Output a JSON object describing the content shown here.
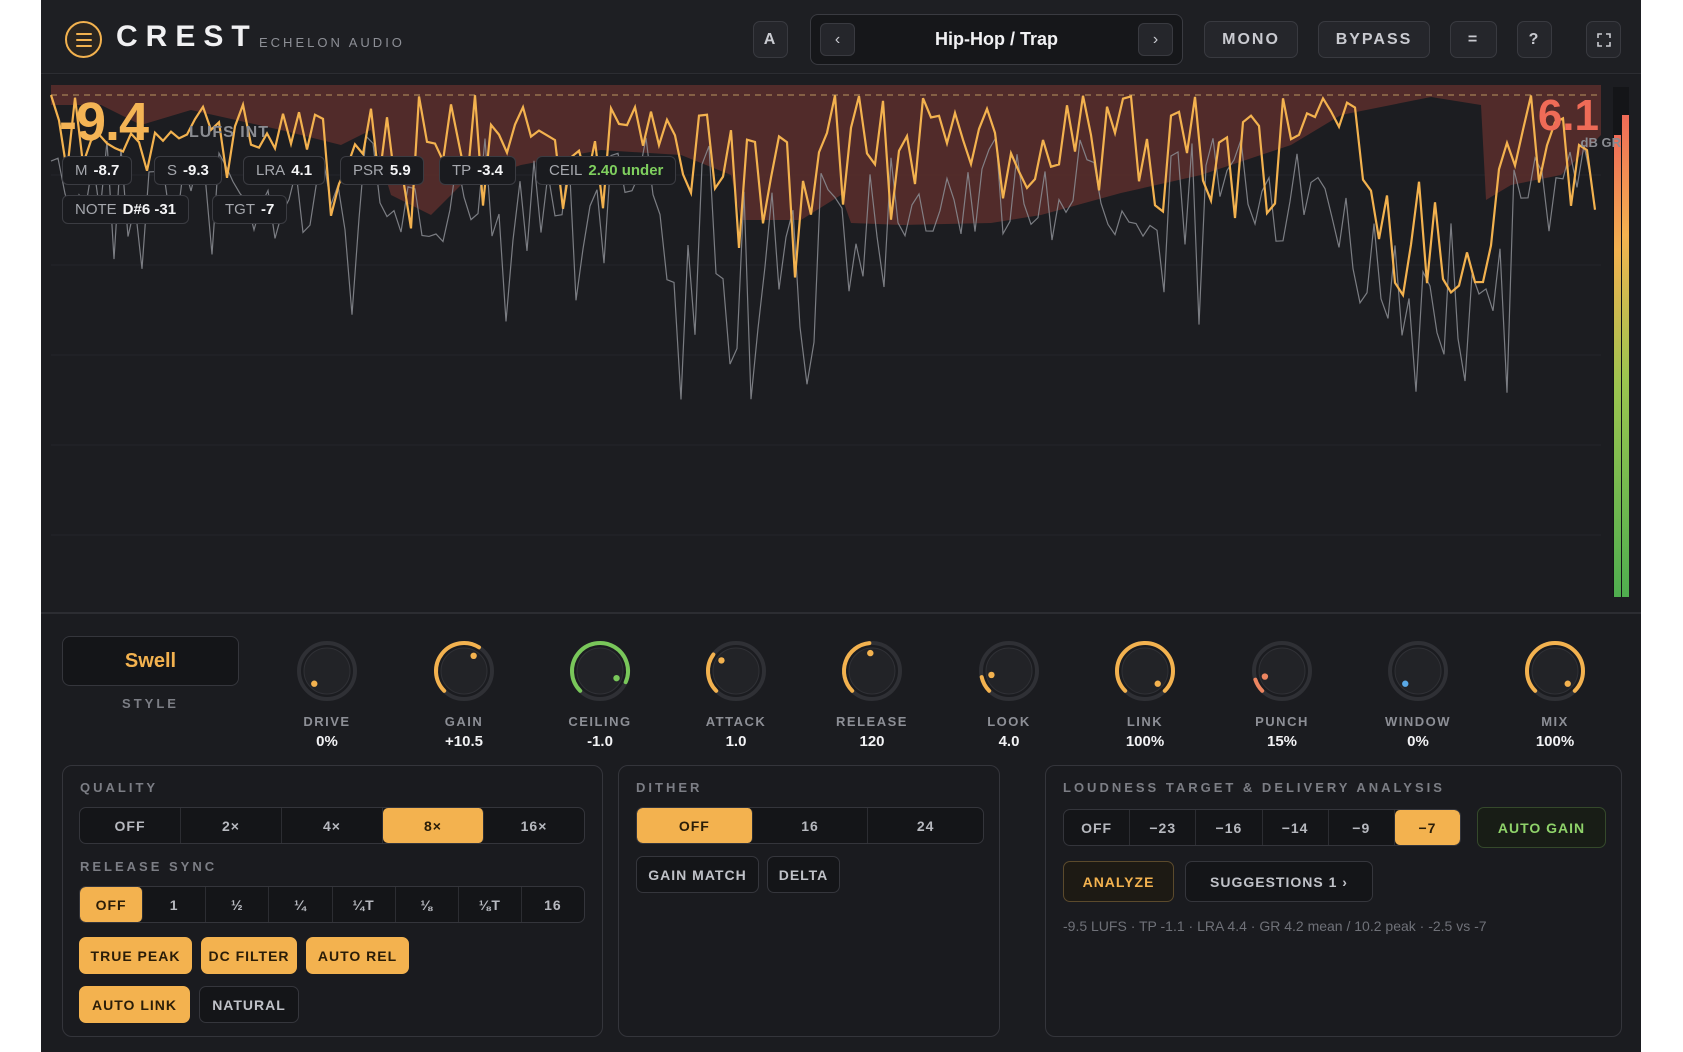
{
  "header": {
    "brand": "CREST",
    "maker": "ECHELON AUDIO",
    "ab_label": "A",
    "prev_label": "‹",
    "preset_name": "Hip-Hop / Trap",
    "next_label": "›",
    "mono_label": "MONO",
    "bypass_label": "BYPASS",
    "compare_label": "=",
    "help_label": "?"
  },
  "display": {
    "lufs_value": "-9.4",
    "lufs_unit": "LUFS INT",
    "gr_value": "6.1",
    "gr_unit": "dB GR",
    "chips": [
      {
        "label": "M",
        "value": "-8.7"
      },
      {
        "label": "S",
        "value": "-9.3"
      },
      {
        "label": "LRA",
        "value": "4.1"
      },
      {
        "label": "PSR",
        "value": "5.9"
      },
      {
        "label": "TP",
        "value": "-3.4"
      },
      {
        "label": "CEIL",
        "value": "2.40 under"
      },
      {
        "label": "NOTE",
        "value": "D#6 -31"
      },
      {
        "label": "TGT",
        "value": "-7"
      }
    ]
  },
  "style": {
    "value": "Swell",
    "label": "STYLE"
  },
  "knobs": [
    {
      "label": "DRIVE",
      "value": "0%",
      "level": 0.0,
      "color": "#f3b24f"
    },
    {
      "label": "GAIN",
      "value": "+10.5",
      "level": 0.62,
      "color": "#f3b24f"
    },
    {
      "label": "CEILING",
      "value": "-1.0",
      "level": 0.92,
      "color": "#79c75a"
    },
    {
      "label": "ATTACK",
      "value": "1.0",
      "level": 0.3,
      "color": "#f3b24f"
    },
    {
      "label": "RELEASE",
      "value": "120",
      "level": 0.48,
      "color": "#f3b24f"
    },
    {
      "label": "LOOK",
      "value": "4.0",
      "level": 0.12,
      "color": "#f3b24f"
    },
    {
      "label": "LINK",
      "value": "100%",
      "level": 1.0,
      "color": "#f3b24f"
    },
    {
      "label": "PUNCH",
      "value": "15%",
      "level": 0.1,
      "color": "#ec8560"
    },
    {
      "label": "WINDOW",
      "value": "0%",
      "level": 0.0,
      "color": "#5aa9e6"
    },
    {
      "label": "MIX",
      "value": "100%",
      "level": 1.0,
      "color": "#f3b24f"
    }
  ],
  "quality": {
    "title": "QUALITY",
    "options": [
      "OFF",
      "2×",
      "4×",
      "8×",
      "16×"
    ],
    "selected": "8×",
    "release_sync_title": "RELEASE SYNC",
    "release_sync_options": [
      "OFF",
      "1",
      "½",
      "¼",
      "¼T",
      "⅛",
      "⅛T",
      "16"
    ],
    "release_sync_selected": "OFF",
    "toggles_row1": [
      "TRUE PEAK",
      "DC FILTER",
      "AUTO REL"
    ],
    "toggles_row2_on": "AUTO LINK",
    "toggles_row2_off": "NATURAL"
  },
  "dither": {
    "title": "DITHER",
    "options": [
      "OFF",
      "16",
      "24"
    ],
    "selected": "OFF",
    "gain_match": "GAIN MATCH",
    "delta": "DELTA"
  },
  "loudness": {
    "title": "LOUDNESS TARGET & DELIVERY ANALYSIS",
    "options": [
      "OFF",
      "−23",
      "−16",
      "−14",
      "−9",
      "−7"
    ],
    "selected": "−7",
    "auto_gain": "AUTO GAIN",
    "analyze": "ANALYZE",
    "suggestions": "SUGGESTIONS  1 ›",
    "analysis_text": "-9.5 LUFS · TP -1.1 · LRA 4.4 · GR 4.2 mean / 10.2 peak · -2.5 vs -7"
  },
  "colors": {
    "accent": "#f3b24f",
    "gr_fill": "#5a2e2c",
    "gr_number": "#ef6b57",
    "good": "#7fcf5e"
  }
}
